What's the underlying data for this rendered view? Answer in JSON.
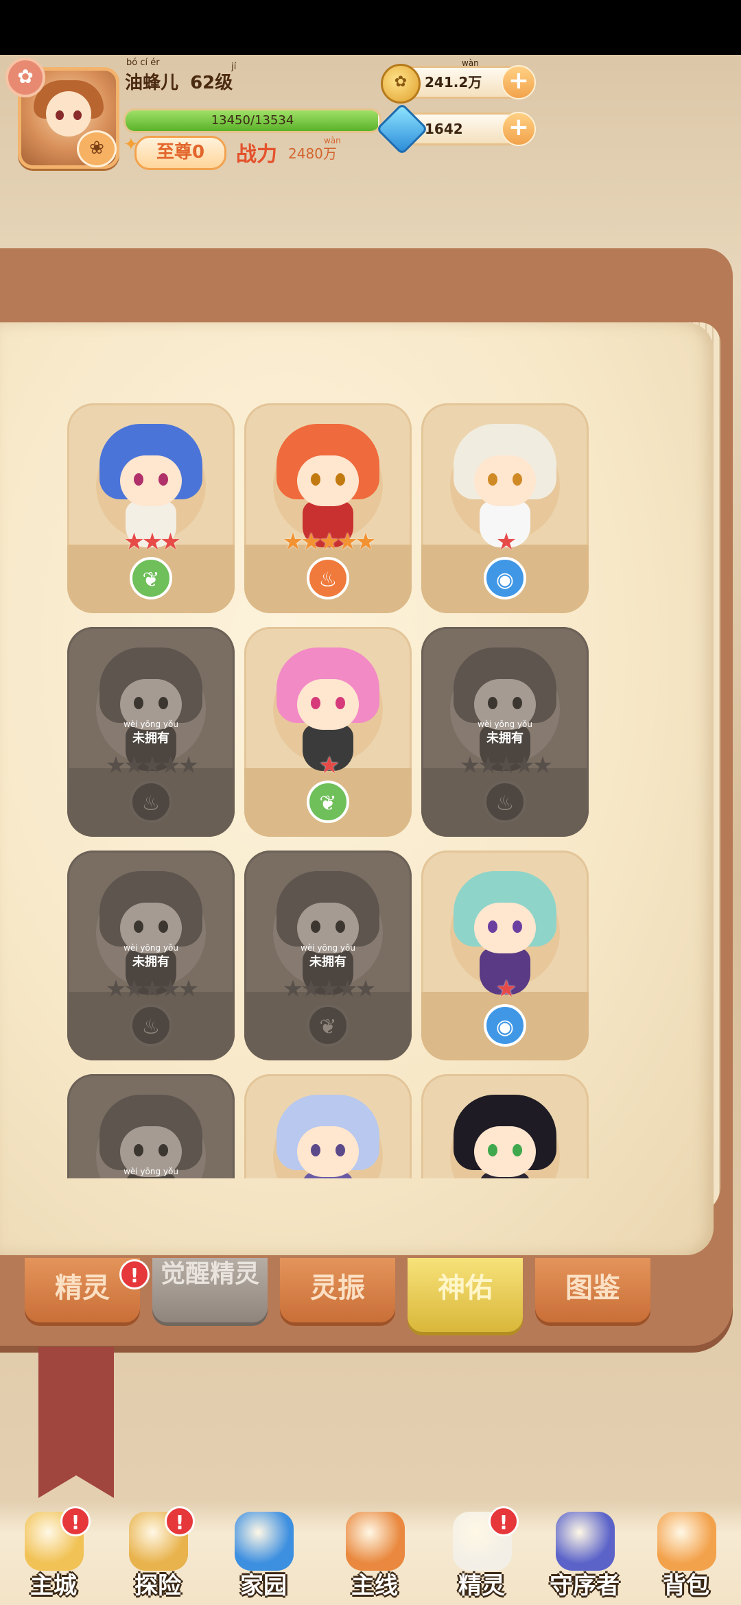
{
  "player": {
    "name": "油蜂儿",
    "name_ruby": "bó  cí  ér",
    "level": "62级",
    "level_ruby": "jí",
    "xp_text": "13450/13534",
    "xp_fraction": 0.9938,
    "vip_label": "至尊0",
    "power_label": "战力",
    "power_value": "2480万",
    "power_ruby": "wàn"
  },
  "resources": {
    "coins": "241.2万",
    "coins_ruby": "wàn",
    "gems": "1642",
    "plus": "+"
  },
  "unowned_label": "未拥有",
  "unowned_ruby": "wèi yōng yǒu",
  "cards": [
    {
      "locked": false,
      "stars": 3,
      "star_color": "red",
      "element": "grass",
      "hair": "#4b74d8",
      "body": "#f4efe5",
      "eye": "#b0306a"
    },
    {
      "locked": false,
      "stars": 5,
      "star_color": "orange",
      "element": "fire",
      "hair": "#ef6a3c",
      "body": "#c8312f",
      "eye": "#c27a10"
    },
    {
      "locked": false,
      "stars": 1,
      "star_color": "red",
      "element": "water",
      "hair": "#f1ece0",
      "body": "#f7f7f7",
      "eye": "#d08a25"
    },
    {
      "locked": true,
      "stars": 5,
      "element": "fire"
    },
    {
      "locked": false,
      "stars": 1,
      "star_color": "red",
      "element": "grass",
      "hair": "#f28ac6",
      "body": "#3b3b3b",
      "eye": "#d63a7a"
    },
    {
      "locked": true,
      "stars": 5,
      "element": "fire"
    },
    {
      "locked": true,
      "stars": 5,
      "element": "fire"
    },
    {
      "locked": true,
      "stars": 5,
      "element": "grass"
    },
    {
      "locked": false,
      "stars": 1,
      "star_color": "red",
      "element": "water",
      "hair": "#8fd4c9",
      "body": "#5a3a84",
      "eye": "#6a3fa0"
    },
    {
      "locked": true,
      "stars": 0,
      "element": "none"
    },
    {
      "locked": false,
      "stars": 0,
      "element": "none",
      "hair": "#b8c8ee",
      "body": "#6a5aa5",
      "eye": "#5b4a8a"
    },
    {
      "locked": false,
      "stars": 0,
      "element": "none",
      "hair": "#1e1b24",
      "body": "#2a2633",
      "eye": "#3fa84d"
    }
  ],
  "icons": {
    "grass": "❦",
    "fire": "♨",
    "water": "◉",
    "star": "★",
    "badge": "!"
  },
  "book_tabs": [
    {
      "label": "精灵",
      "badge": true,
      "state": "normal"
    },
    {
      "label": "觉醒精灵",
      "badge": false,
      "state": "disabled"
    },
    {
      "label": "灵振",
      "badge": false,
      "state": "normal"
    },
    {
      "label": "神佑",
      "badge": false,
      "state": "active"
    },
    {
      "label": "图鉴",
      "badge": false,
      "state": "normal"
    }
  ],
  "nav": [
    {
      "label": "主城",
      "badge": true,
      "icon": "castle-icon",
      "color": "#f1c255"
    },
    {
      "label": "探险",
      "badge": true,
      "icon": "map-icon",
      "color": "#e8b34d"
    },
    {
      "label": "家园",
      "badge": false,
      "icon": "cube-icon",
      "color": "#3d8fe0"
    },
    {
      "label": "主线",
      "badge": false,
      "icon": "fox-icon",
      "color": "#e9883e"
    },
    {
      "label": "精灵",
      "badge": true,
      "icon": "sheep-icon",
      "color": "#f3efe6"
    },
    {
      "label": "守序者",
      "badge": false,
      "icon": "cat-king-icon",
      "color": "#5b63c9"
    },
    {
      "label": "背包",
      "badge": false,
      "icon": "backpack-icon",
      "color": "#f3a24c"
    }
  ],
  "colors": {
    "accent_red": "#e6373b",
    "book_brown": "#b77a56",
    "page_cream": "#f7e8c8"
  }
}
